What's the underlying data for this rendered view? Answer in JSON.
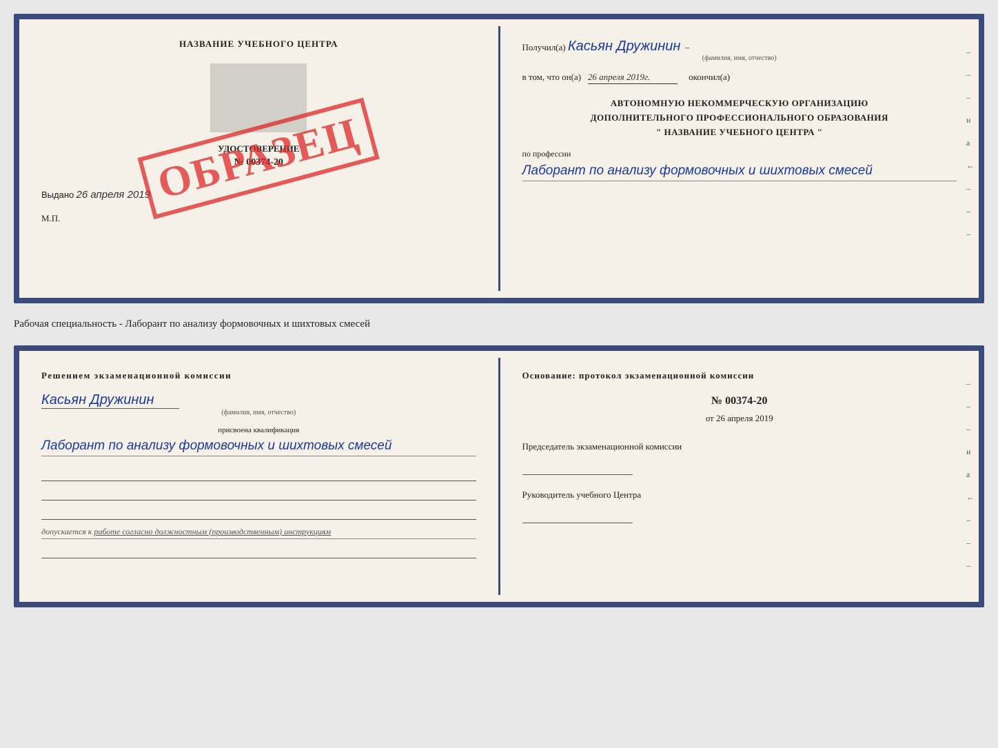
{
  "top_document": {
    "left": {
      "title": "НАЗВАНИЕ УЧЕБНОГО ЦЕНТРА",
      "cert_label": "УДОСТОВЕРЕНИЕ",
      "cert_number": "№ 00374-20",
      "issued_prefix": "Выдано",
      "issued_date": "26 апреля 2019",
      "mp_label": "М.П.",
      "stamp_text": "ОБРАЗЕЦ"
    },
    "right": {
      "received_prefix": "Получил(а)",
      "received_name": "Касьян Дружинин",
      "received_sublabel": "(фамилия, имя, отчество)",
      "date_prefix": "в том, что он(а)",
      "date_value": "26 апреля 2019г.",
      "date_suffix": "окончил(а)",
      "org_line1": "АВТОНОМНУЮ НЕКОММЕРЧЕСКУЮ ОРГАНИЗАЦИЮ",
      "org_line2": "ДОПОЛНИТЕЛЬНОГО ПРОФЕССИОНАЛЬНОГО ОБРАЗОВАНИЯ",
      "org_line3": "\"   НАЗВАНИЕ УЧЕБНОГО ЦЕНТРА   \"",
      "profession_label": "по профессии",
      "profession_value": "Лаборант по анализу формовочных и шихтовых смесей",
      "side_marks": [
        "-",
        "-",
        "-",
        "и",
        "а",
        "←",
        "-",
        "-",
        "-"
      ]
    }
  },
  "between_label": "Рабочая специальность - Лаборант по анализу формовочных и шихтовых смесей",
  "bottom_document": {
    "left": {
      "commission_title": "Решением  экзаменационной  комиссии",
      "person_name": "Касьян  Дружинин",
      "person_sublabel": "(фамилия, имя, отчество)",
      "qual_label": "присвоена квалификация",
      "qual_value": "Лаборант по анализу формовочных и шихтовых смесей",
      "допуск_prefix": "допускается к",
      "допуск_value": "работе согласно должностным (производственным) инструкциям"
    },
    "right": {
      "osnov_title": "Основание: протокол экзаменационной  комиссии",
      "protocol_number": "№  00374-20",
      "protocol_date_prefix": "от",
      "protocol_date": "26 апреля 2019",
      "chairman_label": "Председатель экзаменационной комиссии",
      "rukov_label": "Руководитель учебного Центра",
      "side_marks": [
        "-",
        "-",
        "-",
        "и",
        "а",
        "←",
        "-",
        "-",
        "-"
      ]
    }
  }
}
